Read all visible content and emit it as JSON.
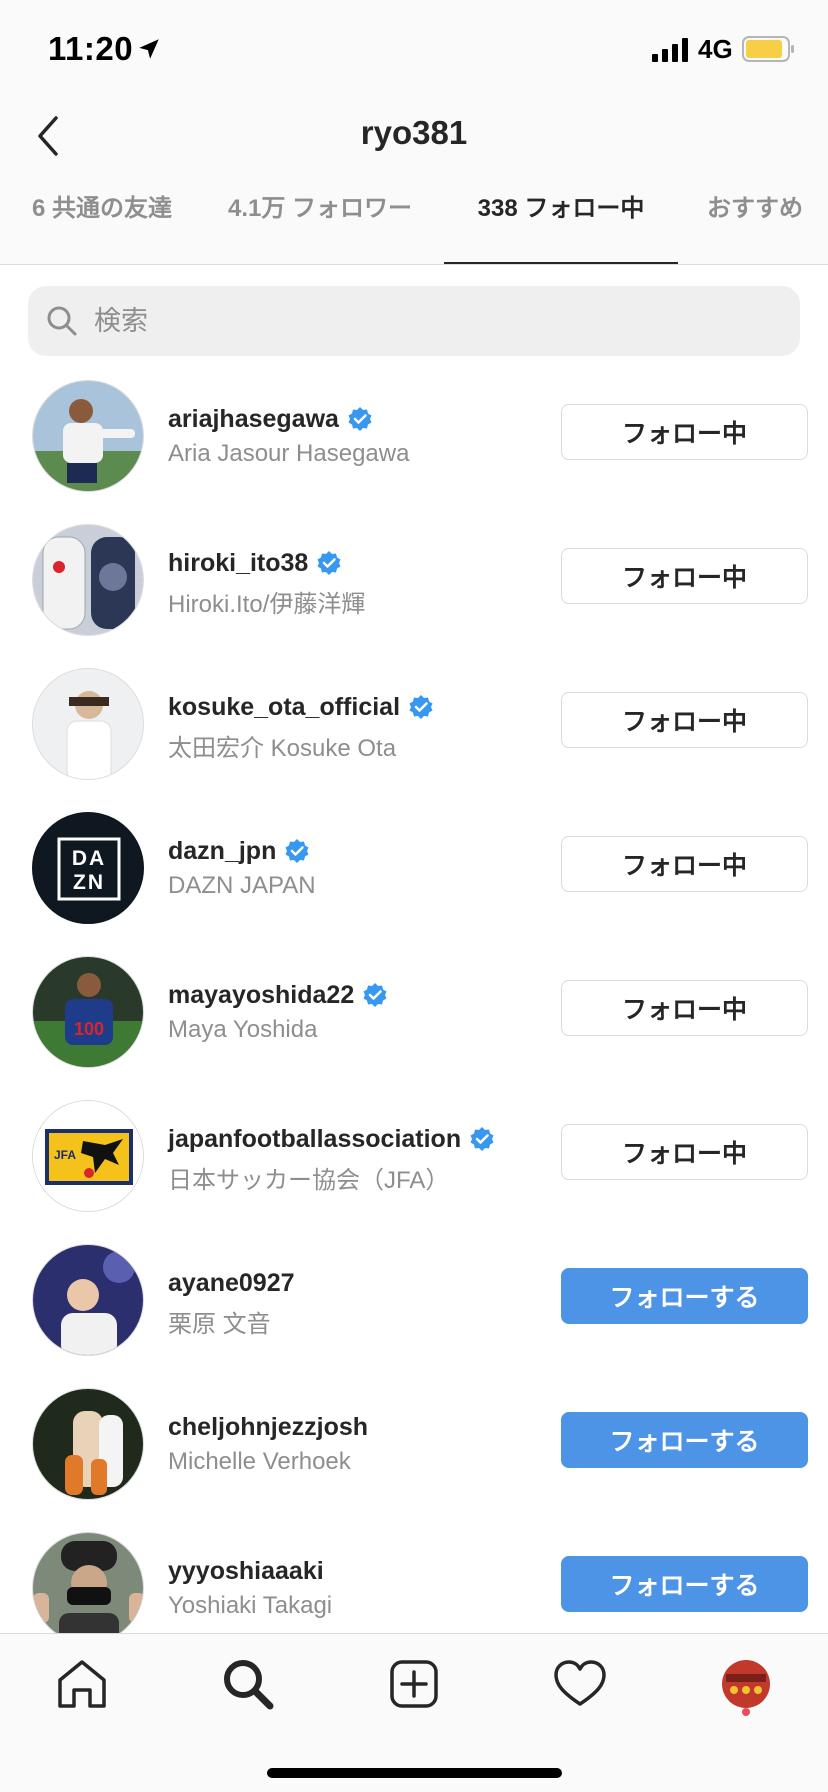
{
  "status_bar": {
    "time": "11:20",
    "network": "4G"
  },
  "header": {
    "title": "ryo381",
    "back_icon": "chevron-left-icon"
  },
  "tabs": [
    {
      "label": "6 共通の友達",
      "active": false
    },
    {
      "label": "4.1万 フォロワー",
      "active": false
    },
    {
      "label": "338 フォロー中",
      "active": true
    },
    {
      "label": "おすすめ",
      "active": false
    }
  ],
  "search": {
    "placeholder": "検索",
    "value": ""
  },
  "colors": {
    "follow_blue": "#4d93e6",
    "verified_blue": "#3897f0",
    "muted_text": "#8e8e8e"
  },
  "users": [
    {
      "username": "ariajhasegawa",
      "full_name": "Aria Jasour Hasegawa",
      "verified": true,
      "button": "フォロー中",
      "following": true
    },
    {
      "username": "hiroki_ito38",
      "full_name": "Hiroki.Ito/伊藤洋輝",
      "verified": true,
      "button": "フォロー中",
      "following": true
    },
    {
      "username": "kosuke_ota_official",
      "full_name": "太田宏介 Kosuke Ota",
      "verified": true,
      "button": "フォロー中",
      "following": true
    },
    {
      "username": "dazn_jpn",
      "full_name": "DAZN JAPAN",
      "verified": true,
      "button": "フォロー中",
      "following": true,
      "logo_text": "DAZN"
    },
    {
      "username": "mayayoshida22",
      "full_name": "Maya Yoshida",
      "verified": true,
      "button": "フォロー中",
      "following": true
    },
    {
      "username": "japanfootballassociation",
      "full_name": "日本サッカー協会（JFA）",
      "verified": true,
      "button": "フォロー中",
      "following": true,
      "logo_text": "JFA"
    },
    {
      "username": "ayane0927",
      "full_name": "栗原 文音",
      "verified": false,
      "button": "フォローする",
      "following": false
    },
    {
      "username": "cheljohnjezzjosh",
      "full_name": "Michelle Verhoek",
      "verified": false,
      "button": "フォローする",
      "following": false
    },
    {
      "username": "yyyoshiaaaki",
      "full_name": "Yoshiaki Takagi",
      "verified": false,
      "button": "フォローする",
      "following": false
    }
  ],
  "bottom_nav": [
    "home-icon",
    "search-icon",
    "add-post-icon",
    "activity-heart-icon",
    "profile-avatar"
  ]
}
